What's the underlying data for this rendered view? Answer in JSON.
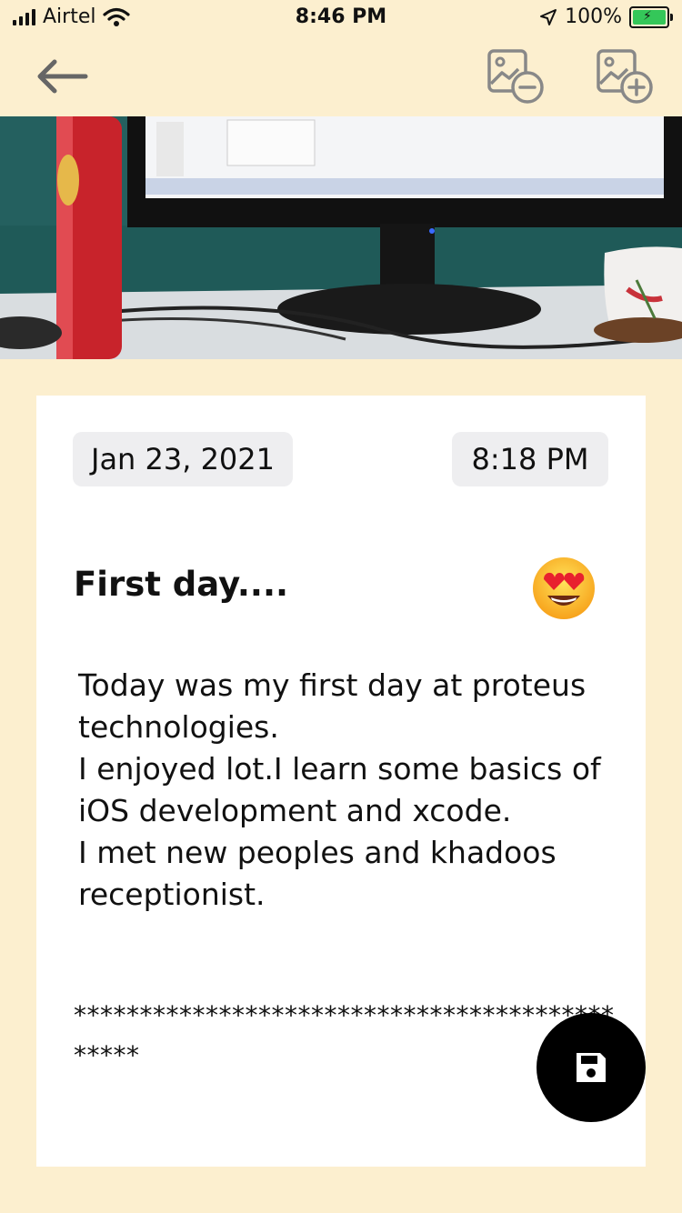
{
  "status_bar": {
    "carrier": "Airtel",
    "time": "8:46 PM",
    "battery": "100%"
  },
  "nav": {
    "back_icon": "arrow-left-icon",
    "remove_image_icon": "image-remove-icon",
    "add_image_icon": "image-add-icon"
  },
  "entry": {
    "date": "Jan 23, 2021",
    "time": "8:18 PM",
    "title": "First day....",
    "mood_icon": "heart-eyes-emoji-icon",
    "body": "Today was my first day at proteus technologies.\nI enjoyed lot.I learn some basics of iOS development and xcode.\nI met new peoples and khadoos receptionist.",
    "footer": "**********************************************"
  },
  "fab": {
    "icon": "save-icon"
  },
  "colors": {
    "background": "#FCEFCF",
    "card": "#FFFFFF",
    "pill": "#EEEEF0",
    "fab": "#000000"
  }
}
